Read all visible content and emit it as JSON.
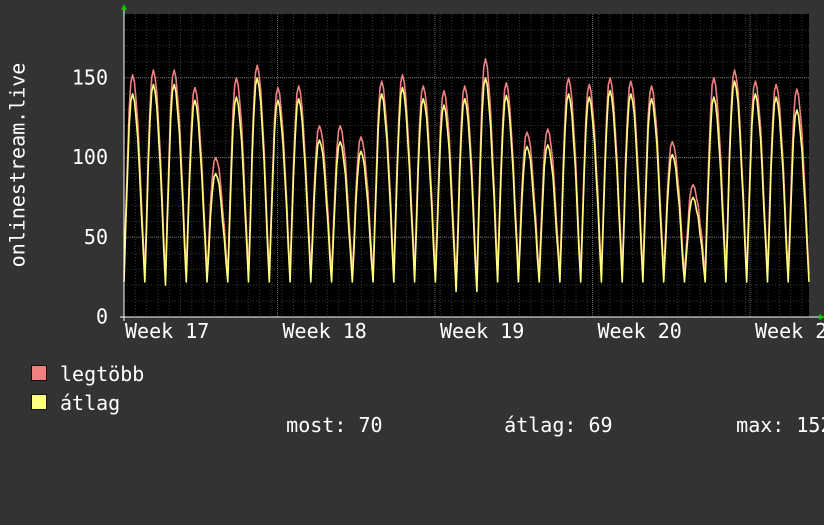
{
  "chart_data": {
    "type": "line",
    "ylabel": "onlinestream.live",
    "ylim": [
      0,
      190
    ],
    "yticks": [
      0,
      50,
      100,
      150
    ],
    "xticks": [
      "Week 17",
      "Week 18",
      "Week 19",
      "Week 20",
      "Week 2"
    ],
    "grid": true,
    "colors": {
      "background": "#333333",
      "plot": "#000000",
      "grid": "#555555",
      "axis": "#ffffff"
    },
    "series": [
      {
        "name": "legtöbb",
        "color": "#f08080",
        "peaks": [
          152,
          155,
          155,
          144,
          100,
          150,
          158,
          144,
          145,
          120,
          120,
          113,
          148,
          152,
          145,
          142,
          145,
          162,
          147,
          116,
          118,
          150,
          146,
          150,
          148,
          145,
          110,
          83,
          150,
          155,
          148,
          146,
          143
        ],
        "troughs": [
          27,
          25,
          27,
          27,
          27,
          27,
          27,
          27,
          27,
          27,
          27,
          27,
          27,
          27,
          27,
          22,
          22,
          27,
          27,
          27,
          27,
          27,
          27,
          27,
          27,
          27,
          27,
          27,
          27,
          27,
          27,
          27,
          27
        ]
      },
      {
        "name": "átlag",
        "color": "#ffff80",
        "peaks": [
          140,
          146,
          146,
          136,
          90,
          138,
          150,
          136,
          137,
          111,
          110,
          104,
          140,
          144,
          137,
          133,
          137,
          150,
          139,
          107,
          108,
          140,
          138,
          142,
          140,
          137,
          102,
          75,
          138,
          148,
          140,
          138,
          130
        ],
        "troughs": [
          22,
          20,
          22,
          22,
          22,
          22,
          22,
          22,
          22,
          22,
          22,
          22,
          22,
          22,
          22,
          16,
          16,
          22,
          22,
          22,
          22,
          22,
          22,
          22,
          22,
          22,
          22,
          22,
          22,
          22,
          22,
          22,
          22
        ]
      }
    ]
  },
  "legend": {
    "max_label": "legtöbb",
    "avg_label": "átlag",
    "stats": [
      {
        "label": "most:",
        "value": "70"
      },
      {
        "label": "átlag:",
        "value": "69"
      },
      {
        "label": "max:",
        "value": "152"
      }
    ]
  }
}
